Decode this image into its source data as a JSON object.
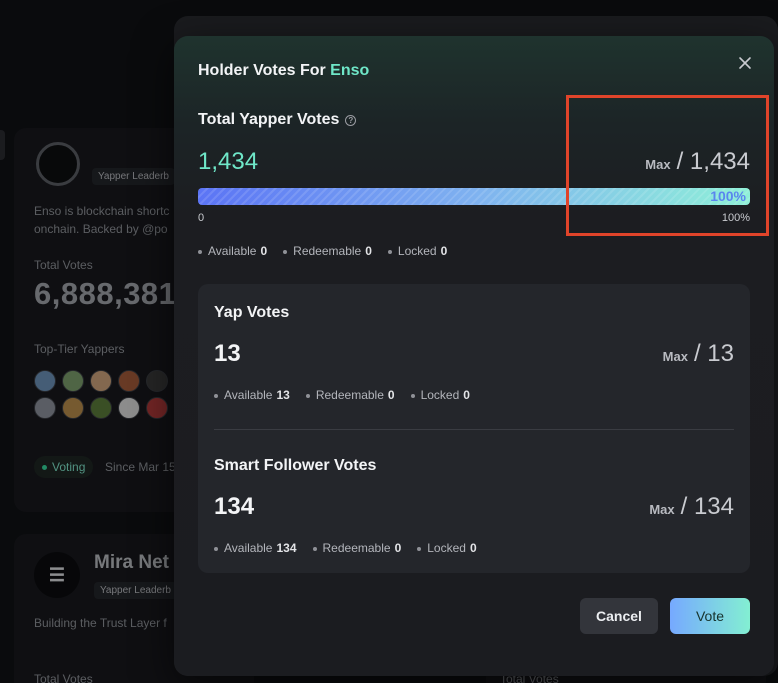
{
  "background": {
    "card1": {
      "tag": "Yapper Leaderb",
      "desc_line1": "Enso is blockchain shortc",
      "desc_line2": "onchain. Backed by @po",
      "total_votes_label": "Total Votes",
      "total_votes_value": "6,888,381",
      "top_tier_label": "Top-Tier Yappers",
      "voting_badge": "Voting",
      "since": "Since Mar 15"
    },
    "card2": {
      "name": "Mira Net",
      "tag": "Yapper Leaderb",
      "desc": "Building the Trust Layer f",
      "total_votes_label": "Total Votes"
    },
    "card3": {
      "total_votes_label": "Total Votes"
    },
    "yapper_colors": [
      "#6b8fb5",
      "#7a9c6b",
      "#c9a07a",
      "#a05a3a",
      "#3a3a3a",
      "#8a8f9a",
      "#b58a4a",
      "#5a7a3a",
      "#d8d8d8",
      "#b03a3a"
    ]
  },
  "modal": {
    "title_prefix": "Holder Votes For",
    "title_project": "Enso",
    "close_icon": "close-icon",
    "total": {
      "label": "Total Yapper Votes",
      "value": "1,434",
      "max_label": "Max",
      "max_value": "/ 1,434",
      "progress_fraction": 1.0,
      "progress_label": "100%",
      "scale_min": "0",
      "scale_max": "100%",
      "available_label": "Available",
      "available": "0",
      "redeemable_label": "Redeemable",
      "redeemable": "0",
      "locked_label": "Locked",
      "locked": "0"
    },
    "yap": {
      "label": "Yap Votes",
      "value": "13",
      "max_label": "Max",
      "max_value": "/ 13",
      "available_label": "Available",
      "available": "13",
      "redeemable_label": "Redeemable",
      "redeemable": "0",
      "locked_label": "Locked",
      "locked": "0"
    },
    "smart": {
      "label": "Smart Follower Votes",
      "value": "134",
      "max_label": "Max",
      "max_value": "/ 134",
      "available_label": "Available",
      "available": "134",
      "redeemable_label": "Redeemable",
      "redeemable": "0",
      "locked_label": "Locked",
      "locked": "0"
    },
    "cancel_label": "Cancel",
    "vote_label": "Vote"
  },
  "colors": {
    "accent": "#6fe7c8",
    "highlight": "#e0442a",
    "progress_start": "#5b74f5",
    "progress_end": "#8ff0d8"
  }
}
